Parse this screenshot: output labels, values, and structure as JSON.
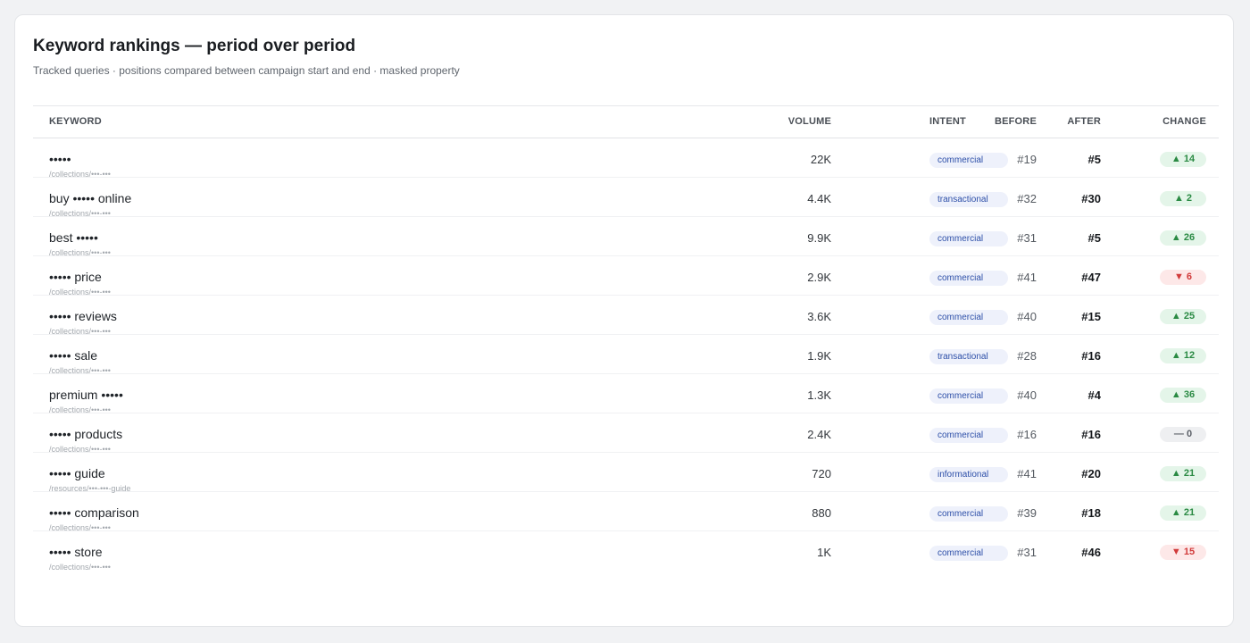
{
  "header": {
    "title": "Keyword rankings — period over period",
    "subtitle": "Tracked queries · positions compared between campaign start and end · masked property"
  },
  "columns": {
    "keyword": "KEYWORD",
    "volume": "VOLUME",
    "intent": "INTENT",
    "before": "BEFORE",
    "after": "AFTER",
    "change": "CHANGE"
  },
  "colors": {
    "up": "#2a8a43",
    "down": "#d13b3b",
    "flat": "#5c6168",
    "intent_text": "#2d4fa8"
  },
  "rows": [
    {
      "keyword": "•••••",
      "url": "/collections/•••-•••",
      "volume": "22K",
      "intent": "commercial",
      "before": "#19",
      "after": "#5",
      "change": "▲ 14",
      "direction": "up"
    },
    {
      "keyword": "buy ••••• online",
      "url": "/collections/•••-•••",
      "volume": "4.4K",
      "intent": "transactional",
      "before": "#32",
      "after": "#30",
      "change": "▲ 2",
      "direction": "up"
    },
    {
      "keyword": "best •••••",
      "url": "/collections/•••-•••",
      "volume": "9.9K",
      "intent": "commercial",
      "before": "#31",
      "after": "#5",
      "change": "▲ 26",
      "direction": "up"
    },
    {
      "keyword": "••••• price",
      "url": "/collections/•••-•••",
      "volume": "2.9K",
      "intent": "commercial",
      "before": "#41",
      "after": "#47",
      "change": "▼ 6",
      "direction": "down"
    },
    {
      "keyword": "••••• reviews",
      "url": "/collections/•••-•••",
      "volume": "3.6K",
      "intent": "commercial",
      "before": "#40",
      "after": "#15",
      "change": "▲ 25",
      "direction": "up"
    },
    {
      "keyword": "••••• sale",
      "url": "/collections/•••-•••",
      "volume": "1.9K",
      "intent": "transactional",
      "before": "#28",
      "after": "#16",
      "change": "▲ 12",
      "direction": "up"
    },
    {
      "keyword": "premium •••••",
      "url": "/collections/•••-•••",
      "volume": "1.3K",
      "intent": "commercial",
      "before": "#40",
      "after": "#4",
      "change": "▲ 36",
      "direction": "up"
    },
    {
      "keyword": "••••• products",
      "url": "/collections/•••-•••",
      "volume": "2.4K",
      "intent": "commercial",
      "before": "#16",
      "after": "#16",
      "change": "— 0",
      "direction": "flat"
    },
    {
      "keyword": "••••• guide",
      "url": "/resources/•••-•••-guide",
      "volume": "720",
      "intent": "informational",
      "before": "#41",
      "after": "#20",
      "change": "▲ 21",
      "direction": "up"
    },
    {
      "keyword": "••••• comparison",
      "url": "/collections/•••-•••",
      "volume": "880",
      "intent": "commercial",
      "before": "#39",
      "after": "#18",
      "change": "▲ 21",
      "direction": "up"
    },
    {
      "keyword": "••••• store",
      "url": "/collections/•••-•••",
      "volume": "1K",
      "intent": "commercial",
      "before": "#31",
      "after": "#46",
      "change": "▼ 15",
      "direction": "down"
    }
  ]
}
